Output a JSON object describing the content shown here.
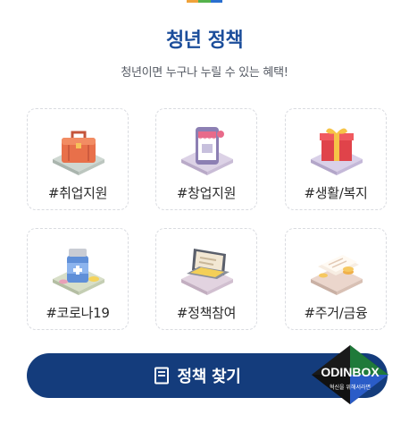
{
  "header": {
    "title": "청년 정책",
    "subtitle": "청년이면 누구나 누릴 수 있는 혜택!"
  },
  "accent_colors": [
    "#f0a23a",
    "#55b24c",
    "#2a6fcf"
  ],
  "categories": [
    {
      "label": "#취업지원",
      "icon": "briefcase-icon"
    },
    {
      "label": "#창업지원",
      "icon": "storefront-phone-icon"
    },
    {
      "label": "#생활/복지",
      "icon": "gift-box-icon"
    },
    {
      "label": "#코로나19",
      "icon": "medicine-icon"
    },
    {
      "label": "#정책참여",
      "icon": "laptop-icon"
    },
    {
      "label": "#주거/금융",
      "icon": "documents-coins-icon"
    }
  ],
  "cta": {
    "label": "정책 찾기",
    "icon": "document-icon",
    "background": "#143c7c"
  },
  "logo": {
    "text": "ODINBOX",
    "tagline": "혁신을 위해서라면"
  }
}
